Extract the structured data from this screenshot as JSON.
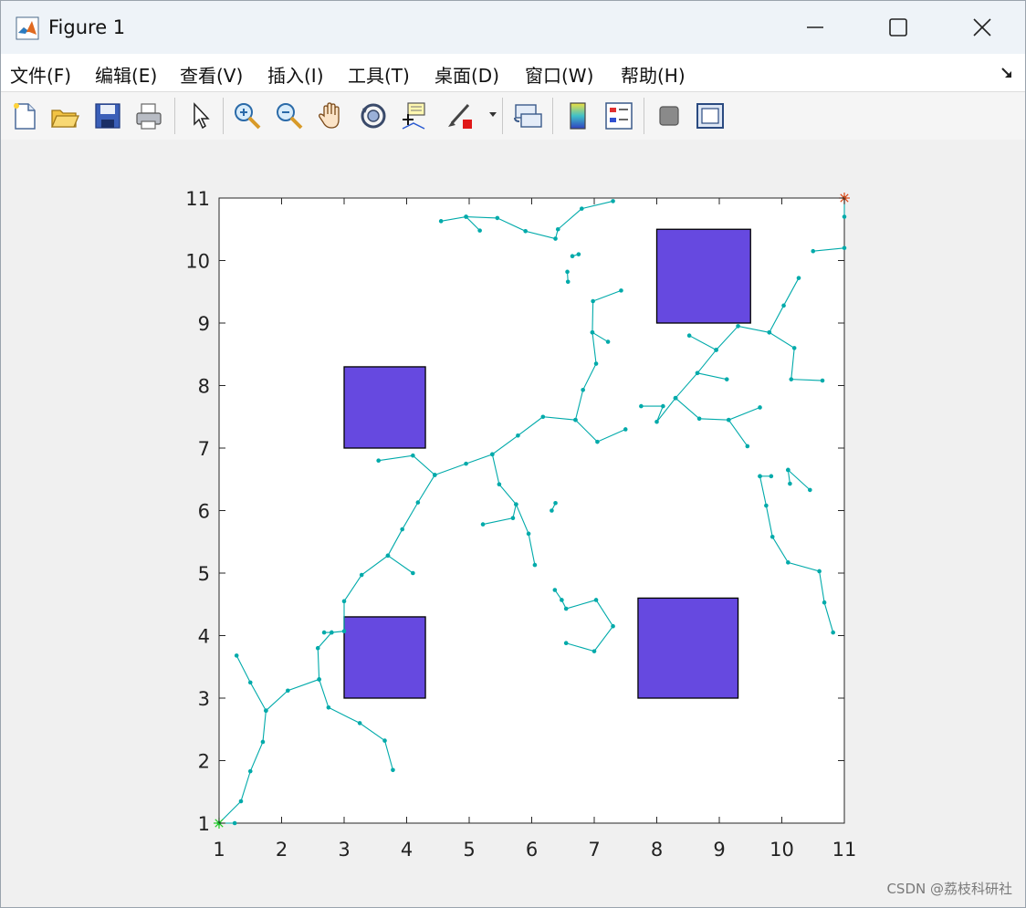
{
  "window": {
    "title": "Figure 1",
    "controls": {
      "minimize": "minimize",
      "maximize": "maximize",
      "close": "close"
    }
  },
  "menu": {
    "items": [
      "文件(F)",
      "编辑(E)",
      "查看(V)",
      "插入(I)",
      "工具(T)",
      "桌面(D)",
      "窗口(W)",
      "帮助(H)"
    ]
  },
  "toolbar": {
    "buttons": [
      {
        "name": "new-figure-icon"
      },
      {
        "name": "open-file-icon"
      },
      {
        "name": "save-icon"
      },
      {
        "name": "print-icon"
      },
      {
        "name": "edit-plot-arrow-icon"
      },
      {
        "name": "zoom-in-icon"
      },
      {
        "name": "zoom-out-icon"
      },
      {
        "name": "pan-hand-icon"
      },
      {
        "name": "rotate-3d-icon"
      },
      {
        "name": "data-cursor-icon"
      },
      {
        "name": "brush-icon"
      },
      {
        "name": "link-plot-icon"
      },
      {
        "name": "colorbar-icon"
      },
      {
        "name": "legend-icon"
      },
      {
        "name": "hide-plot-tools-icon"
      },
      {
        "name": "show-plot-tools-icon"
      }
    ]
  },
  "chart_data": {
    "type": "scatter",
    "xlim": [
      1,
      11
    ],
    "ylim": [
      1,
      11
    ],
    "xticks": [
      "1",
      "2",
      "3",
      "4",
      "5",
      "6",
      "7",
      "8",
      "9",
      "10",
      "11"
    ],
    "yticks": [
      "1",
      "2",
      "3",
      "4",
      "5",
      "6",
      "7",
      "8",
      "9",
      "10",
      "11"
    ],
    "grid": false,
    "colors": {
      "tree": "#00aaaa",
      "obstacle_fill": "#6649e0",
      "obstacle_edge": "#000000",
      "start": "#22cc22",
      "goal": "#dd4411"
    },
    "start": [
      1,
      1
    ],
    "goal": [
      11,
      11
    ],
    "obstacles": [
      {
        "x": 3,
        "y": 7,
        "w": 1.3,
        "h": 1.3
      },
      {
        "x": 3,
        "y": 3,
        "w": 1.3,
        "h": 1.3
      },
      {
        "x": 8,
        "y": 9,
        "w": 1.5,
        "h": 1.5
      },
      {
        "x": 7.7,
        "y": 3,
        "w": 1.6,
        "h": 1.6
      }
    ],
    "tree_paths": [
      [
        [
          1,
          1
        ],
        [
          1.25,
          1
        ]
      ],
      [
        [
          1,
          1
        ],
        [
          1.35,
          1.35
        ],
        [
          1.5,
          1.83
        ],
        [
          1.7,
          2.3
        ],
        [
          1.75,
          2.8
        ],
        [
          1.5,
          3.25
        ],
        [
          1.28,
          3.68
        ]
      ],
      [
        [
          1.75,
          2.8
        ],
        [
          2.1,
          3.12
        ],
        [
          2.6,
          3.3
        ],
        [
          2.58,
          3.8
        ],
        [
          2.8,
          4.05
        ],
        [
          3,
          4.07
        ],
        [
          3,
          4.55
        ],
        [
          3.28,
          4.97
        ],
        [
          3.7,
          5.28
        ],
        [
          3.93,
          5.7
        ],
        [
          4.18,
          6.13
        ],
        [
          4.45,
          6.57
        ],
        [
          4.1,
          6.88
        ],
        [
          3.55,
          6.8
        ]
      ],
      [
        [
          2.6,
          3.3
        ],
        [
          2.75,
          2.85
        ],
        [
          3.25,
          2.6
        ],
        [
          3.65,
          2.32
        ],
        [
          3.78,
          1.85
        ]
      ],
      [
        [
          3.7,
          5.28
        ],
        [
          4.1,
          5
        ]
      ],
      [
        [
          2.8,
          4.05
        ],
        [
          2.68,
          4.05
        ]
      ],
      [
        [
          4.45,
          6.57
        ],
        [
          4.95,
          6.75
        ],
        [
          5.37,
          6.9
        ],
        [
          5.78,
          7.2
        ],
        [
          6.18,
          7.5
        ],
        [
          6.7,
          7.45
        ],
        [
          7.05,
          7.1
        ],
        [
          7.5,
          7.3
        ]
      ],
      [
        [
          5.37,
          6.9
        ],
        [
          5.48,
          6.42
        ],
        [
          5.75,
          6.1
        ],
        [
          5.95,
          5.63
        ],
        [
          6.05,
          5.13
        ]
      ],
      [
        [
          5.75,
          6.1
        ],
        [
          5.7,
          5.88
        ],
        [
          5.22,
          5.78
        ]
      ],
      [
        [
          6.7,
          7.45
        ],
        [
          6.82,
          7.93
        ],
        [
          7.03,
          8.35
        ],
        [
          6.97,
          8.85
        ],
        [
          7.22,
          8.7
        ]
      ],
      [
        [
          6.97,
          8.85
        ],
        [
          6.98,
          9.35
        ],
        [
          7.43,
          9.52
        ]
      ],
      [
        [
          4.55,
          10.63
        ],
        [
          4.95,
          10.7
        ],
        [
          5.45,
          10.68
        ],
        [
          5.9,
          10.47
        ],
        [
          6.38,
          10.35
        ],
        [
          6.42,
          10.5
        ],
        [
          6.8,
          10.83
        ],
        [
          7.3,
          10.95
        ]
      ],
      [
        [
          4.95,
          10.7
        ],
        [
          5.17,
          10.48
        ]
      ],
      [
        [
          6.57,
          9.82
        ],
        [
          6.58,
          9.66
        ]
      ],
      [
        [
          6.65,
          10.07
        ],
        [
          6.75,
          10.1
        ]
      ],
      [
        [
          6.32,
          6.0
        ],
        [
          6.38,
          6.12
        ]
      ],
      [
        [
          6.37,
          4.73
        ],
        [
          6.48,
          4.57
        ],
        [
          6.55,
          4.43
        ],
        [
          7.03,
          4.57
        ],
        [
          7.3,
          4.15
        ],
        [
          7.0,
          3.75
        ],
        [
          6.55,
          3.88
        ]
      ],
      [
        [
          8.3,
          7.8
        ],
        [
          8.0,
          7.42
        ],
        [
          8.1,
          7.67
        ],
        [
          7.75,
          7.67
        ]
      ],
      [
        [
          8.3,
          7.8
        ],
        [
          8.68,
          7.47
        ],
        [
          9.15,
          7.45
        ],
        [
          9.65,
          7.65
        ]
      ],
      [
        [
          9.15,
          7.45
        ],
        [
          9.45,
          7.03
        ]
      ],
      [
        [
          8.3,
          7.8
        ],
        [
          8.65,
          8.2
        ],
        [
          8.95,
          8.57
        ],
        [
          9.3,
          8.95
        ],
        [
          9.8,
          8.85
        ],
        [
          10.2,
          8.6
        ],
        [
          10.15,
          8.1
        ],
        [
          10.65,
          8.08
        ]
      ],
      [
        [
          8.65,
          8.2
        ],
        [
          9.12,
          8.1
        ]
      ],
      [
        [
          8.95,
          8.57
        ],
        [
          8.52,
          8.8
        ]
      ],
      [
        [
          9.8,
          8.85
        ],
        [
          10.03,
          9.28
        ],
        [
          10.27,
          9.72
        ]
      ],
      [
        [
          10.5,
          10.15
        ],
        [
          11,
          10.2
        ]
      ],
      [
        [
          11,
          10.7
        ],
        [
          11,
          11
        ]
      ],
      [
        [
          9.65,
          6.55
        ],
        [
          9.83,
          6.55
        ]
      ],
      [
        [
          9.65,
          6.55
        ],
        [
          9.75,
          6.08
        ],
        [
          9.85,
          5.58
        ],
        [
          10.1,
          5.17
        ],
        [
          10.6,
          5.03
        ],
        [
          10.68,
          4.53
        ],
        [
          10.82,
          4.05
        ]
      ],
      [
        [
          10.1,
          6.65
        ],
        [
          10.45,
          6.33
        ]
      ],
      [
        [
          10.1,
          6.65
        ],
        [
          10.13,
          6.43
        ]
      ]
    ]
  },
  "watermark": "CSDN @荔枝科研社"
}
